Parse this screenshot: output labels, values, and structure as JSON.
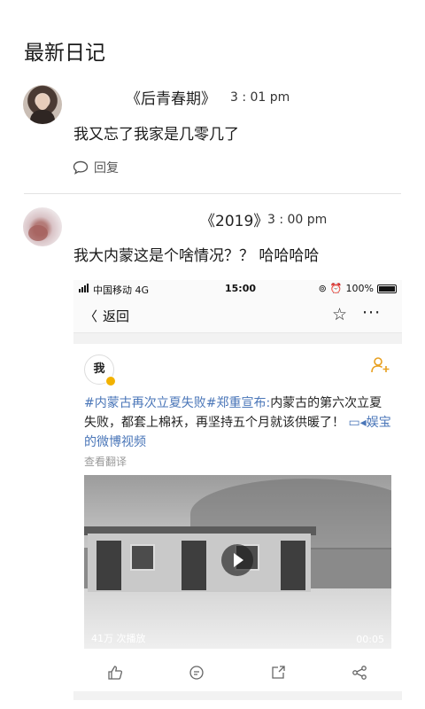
{
  "section": {
    "title": "最新日记"
  },
  "posts": [
    {
      "title": "《后青春期》",
      "time": "3 : 01 pm",
      "body": "我又忘了我家是几零几了",
      "reply_label": "回复"
    },
    {
      "title": "《2019》",
      "time": "3 : 00 pm",
      "body": "我大内蒙这是个啥情况？？ 哈哈哈哈"
    }
  ],
  "screenshot": {
    "status": {
      "carrier": "中国移动  4G",
      "clock": "15:00",
      "battery": "100%"
    },
    "nav": {
      "back_label": "返回"
    },
    "weibo": {
      "avatar_text": "我",
      "tags": "#内蒙古再次立夏失败#郑重宣布:",
      "text": "内蒙古的第六次立夏失败，都套上棉袄，再坚持五个月就该供暖了！",
      "link": "娱宝的微博视频",
      "translate": "查看翻译",
      "views": "41万 次播放",
      "duration": "00:05"
    }
  },
  "icons": [
    "reply-icon",
    "back-chevron-icon",
    "star-icon",
    "more-icon",
    "add-follow-icon",
    "play-icon",
    "video-link-icon",
    "like-icon",
    "comment-icon",
    "repost-icon",
    "share-icon"
  ]
}
